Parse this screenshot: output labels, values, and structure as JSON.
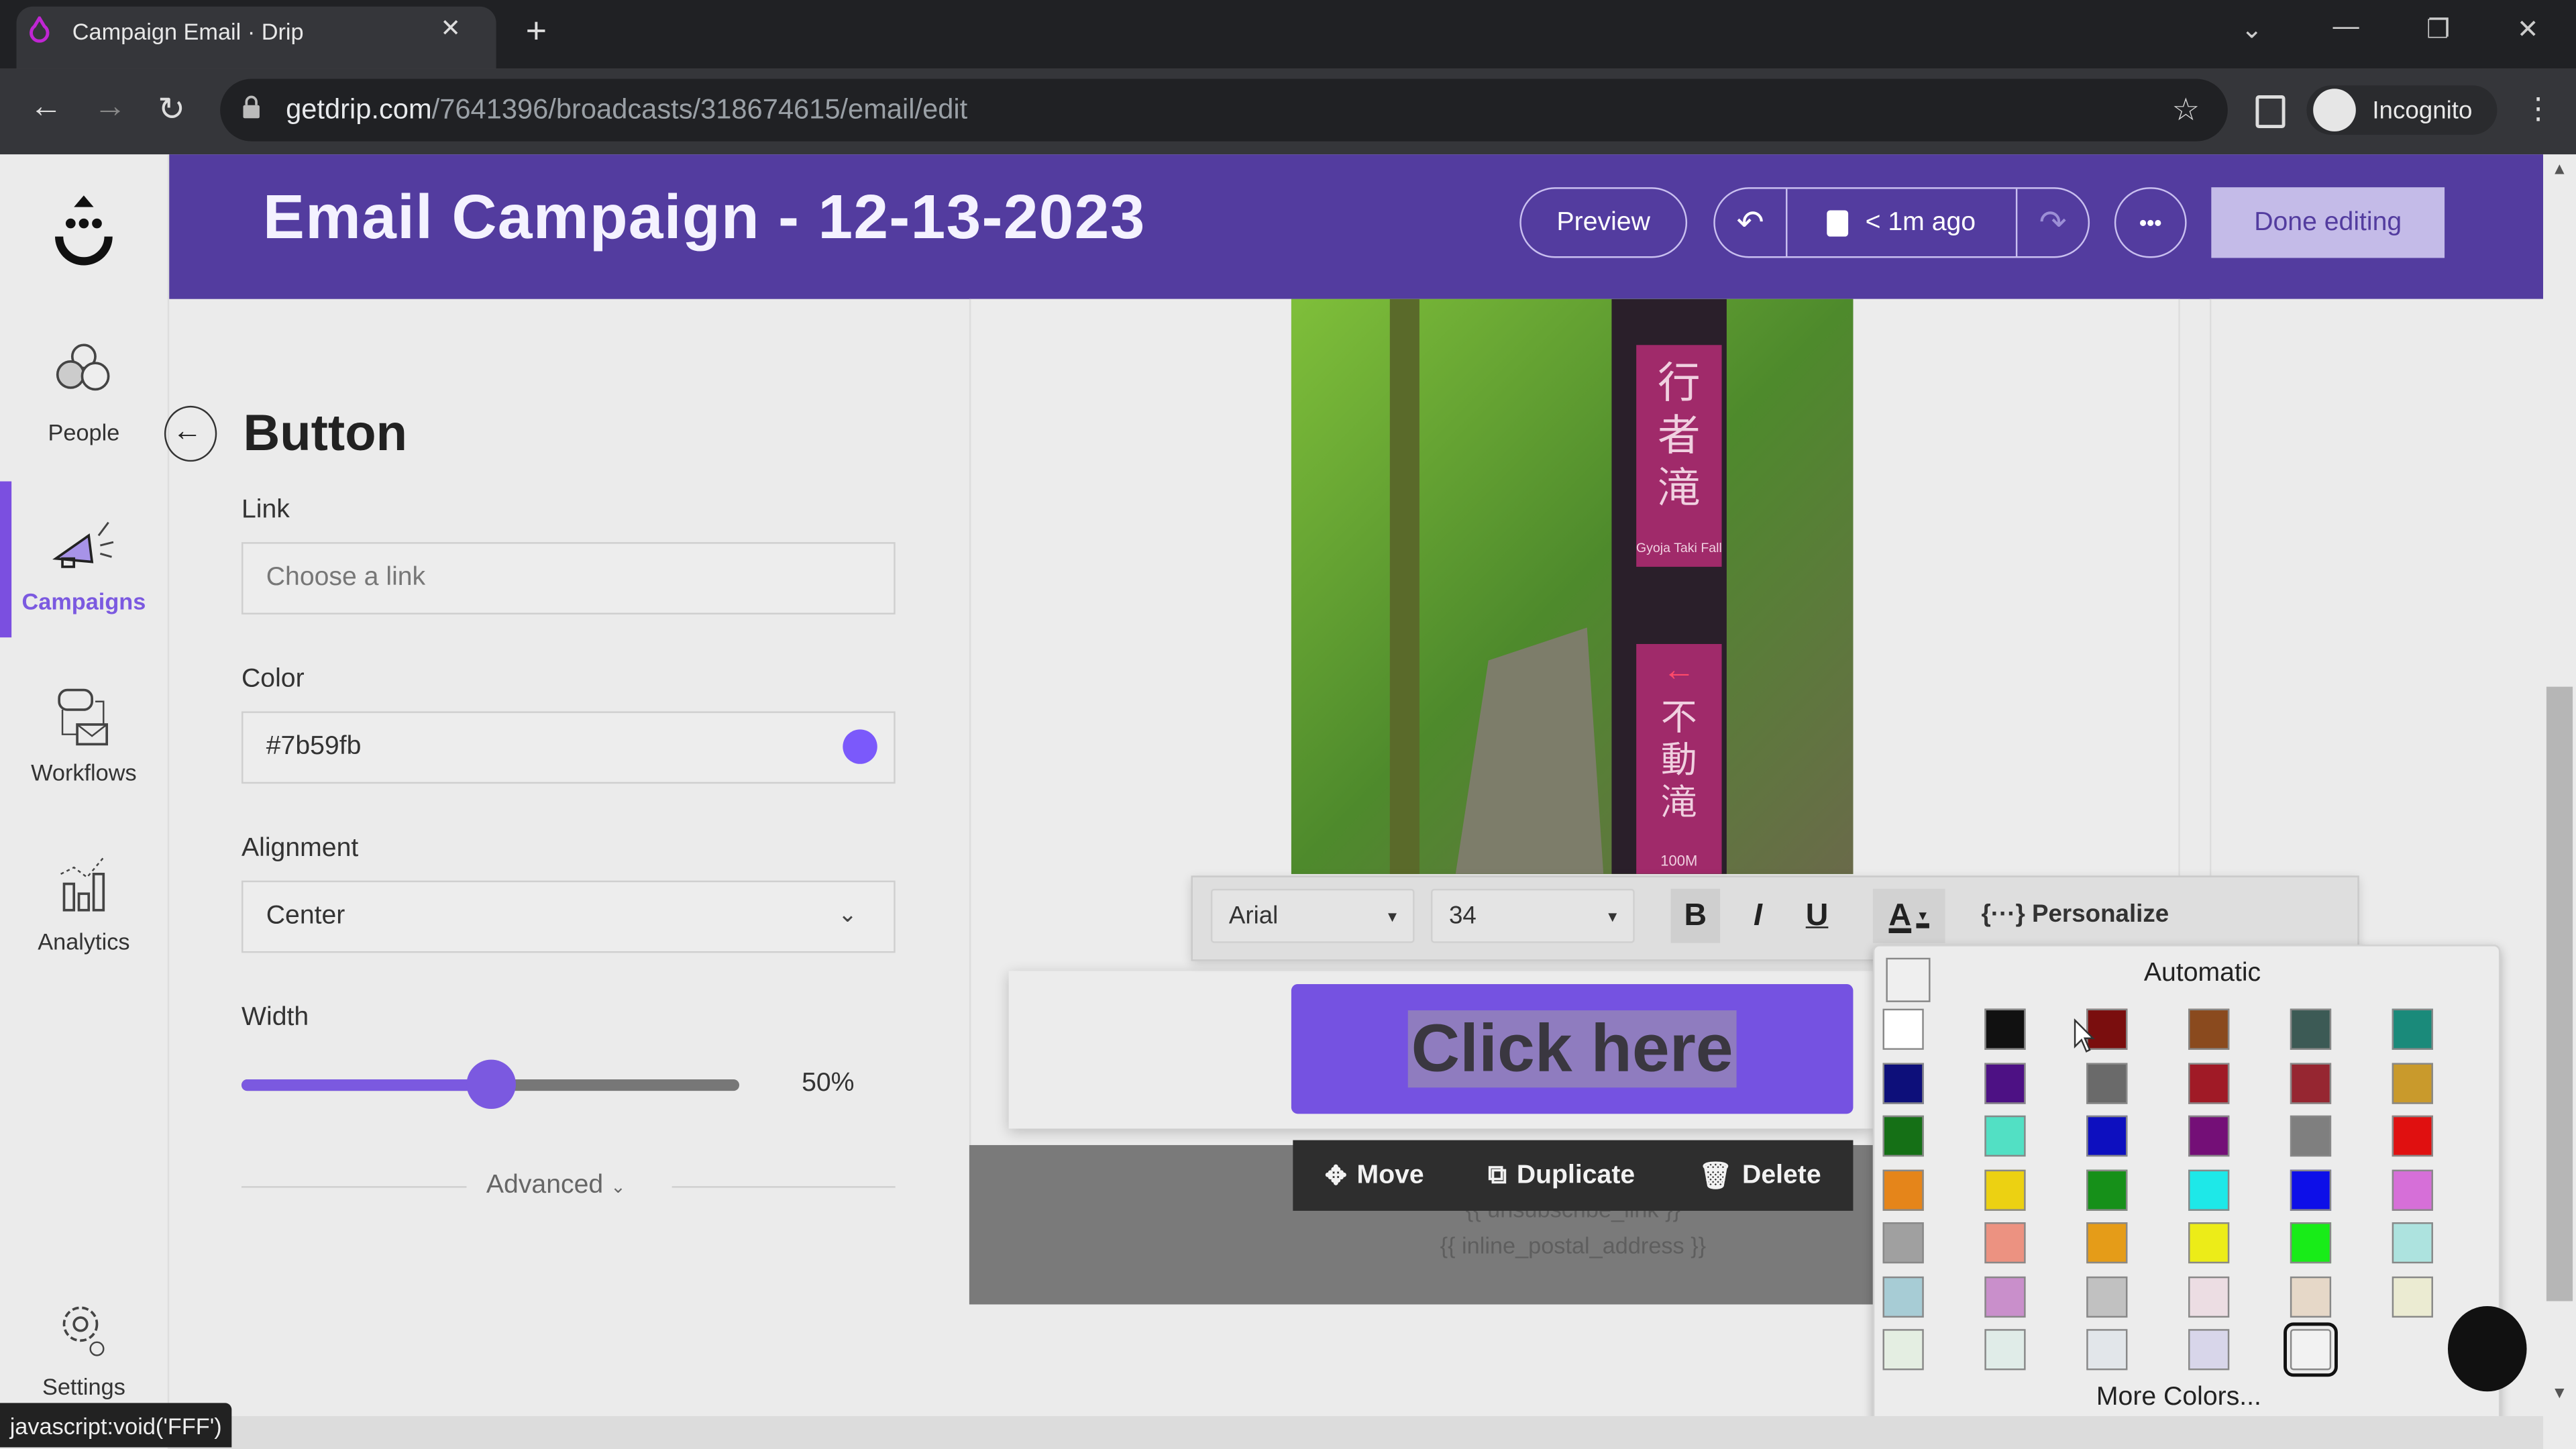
{
  "browser": {
    "tab_title": "Campaign Email · Drip",
    "url_host": "getdrip.com",
    "url_path": "/7641396/broadcasts/318674615/email/edit",
    "profile_label": "Incognito",
    "status_text": "javascript:void('FFF')"
  },
  "nav": {
    "items": [
      {
        "label": "People",
        "icon": "people-icon",
        "active": false
      },
      {
        "label": "Campaigns",
        "icon": "megaphone-icon",
        "active": true
      },
      {
        "label": "Workflows",
        "icon": "workflow-icon",
        "active": false
      },
      {
        "label": "Analytics",
        "icon": "analytics-icon",
        "active": false
      },
      {
        "label": "Settings",
        "icon": "gear-icon",
        "active": false
      }
    ]
  },
  "header": {
    "title": "Email Campaign - 12-13-2023",
    "preview_label": "Preview",
    "save_status": "< 1m ago",
    "more_label": "•••",
    "done_label": "Done editing"
  },
  "panel": {
    "title": "Button",
    "link_label": "Link",
    "link_placeholder": "Choose a link",
    "color_label": "Color",
    "color_value": "#7b59fb",
    "alignment_label": "Alignment",
    "alignment_value": "Center",
    "width_label": "Width",
    "width_value": "50%",
    "width_fraction": 0.5,
    "advanced_label": "Advanced"
  },
  "canvas": {
    "button_text": "Click here",
    "button_color": "#7552e1",
    "footer_lines": [
      "{{ unsubscribe_link }}",
      "{{ inline_postal_address }}"
    ],
    "actions": {
      "move": "Move",
      "duplicate": "Duplicate",
      "delete": "Delete"
    },
    "image_alt": "Forest trail sign: 行者滝 Gyoja Taki Fall / 不動滝まで Fudo Taki Fall 100M"
  },
  "toolbar": {
    "font": "Arial",
    "size": "34",
    "bold": "B",
    "italic": "I",
    "underline": "U",
    "text_color": "A",
    "personalize": "Personalize"
  },
  "color_picker": {
    "automatic_label": "Automatic",
    "more_label": "More Colors...",
    "selected_index": 40,
    "swatches": [
      "#ffffff",
      "#111111",
      "#7a0e0e",
      "#8a4a1e",
      "#3c5a55",
      "#1a8a7a",
      "#0d0f7a",
      "#4d1184",
      "#6a6a6a",
      "#a01a26",
      "#962631",
      "#c99a2c",
      "#157016",
      "#52e0c4",
      "#0d0fbf",
      "#740f77",
      "#7f7f7f",
      "#e01010",
      "#e5851a",
      "#ecd112",
      "#169019",
      "#1ee8e8",
      "#0d0fe8",
      "#d66fd8",
      "#a0a0a0",
      "#ec9281",
      "#e59c18",
      "#ecec18",
      "#18ec18",
      "#ade3df",
      "#a7ccd5",
      "#c98fcb",
      "#c1c1c1",
      "#ecdde3",
      "#e6d8c8",
      "#ebebd2",
      "#e4eee2",
      "#e0ece8",
      "#e2e6ea",
      "#d8d6ea",
      "#f2f2f2"
    ]
  }
}
